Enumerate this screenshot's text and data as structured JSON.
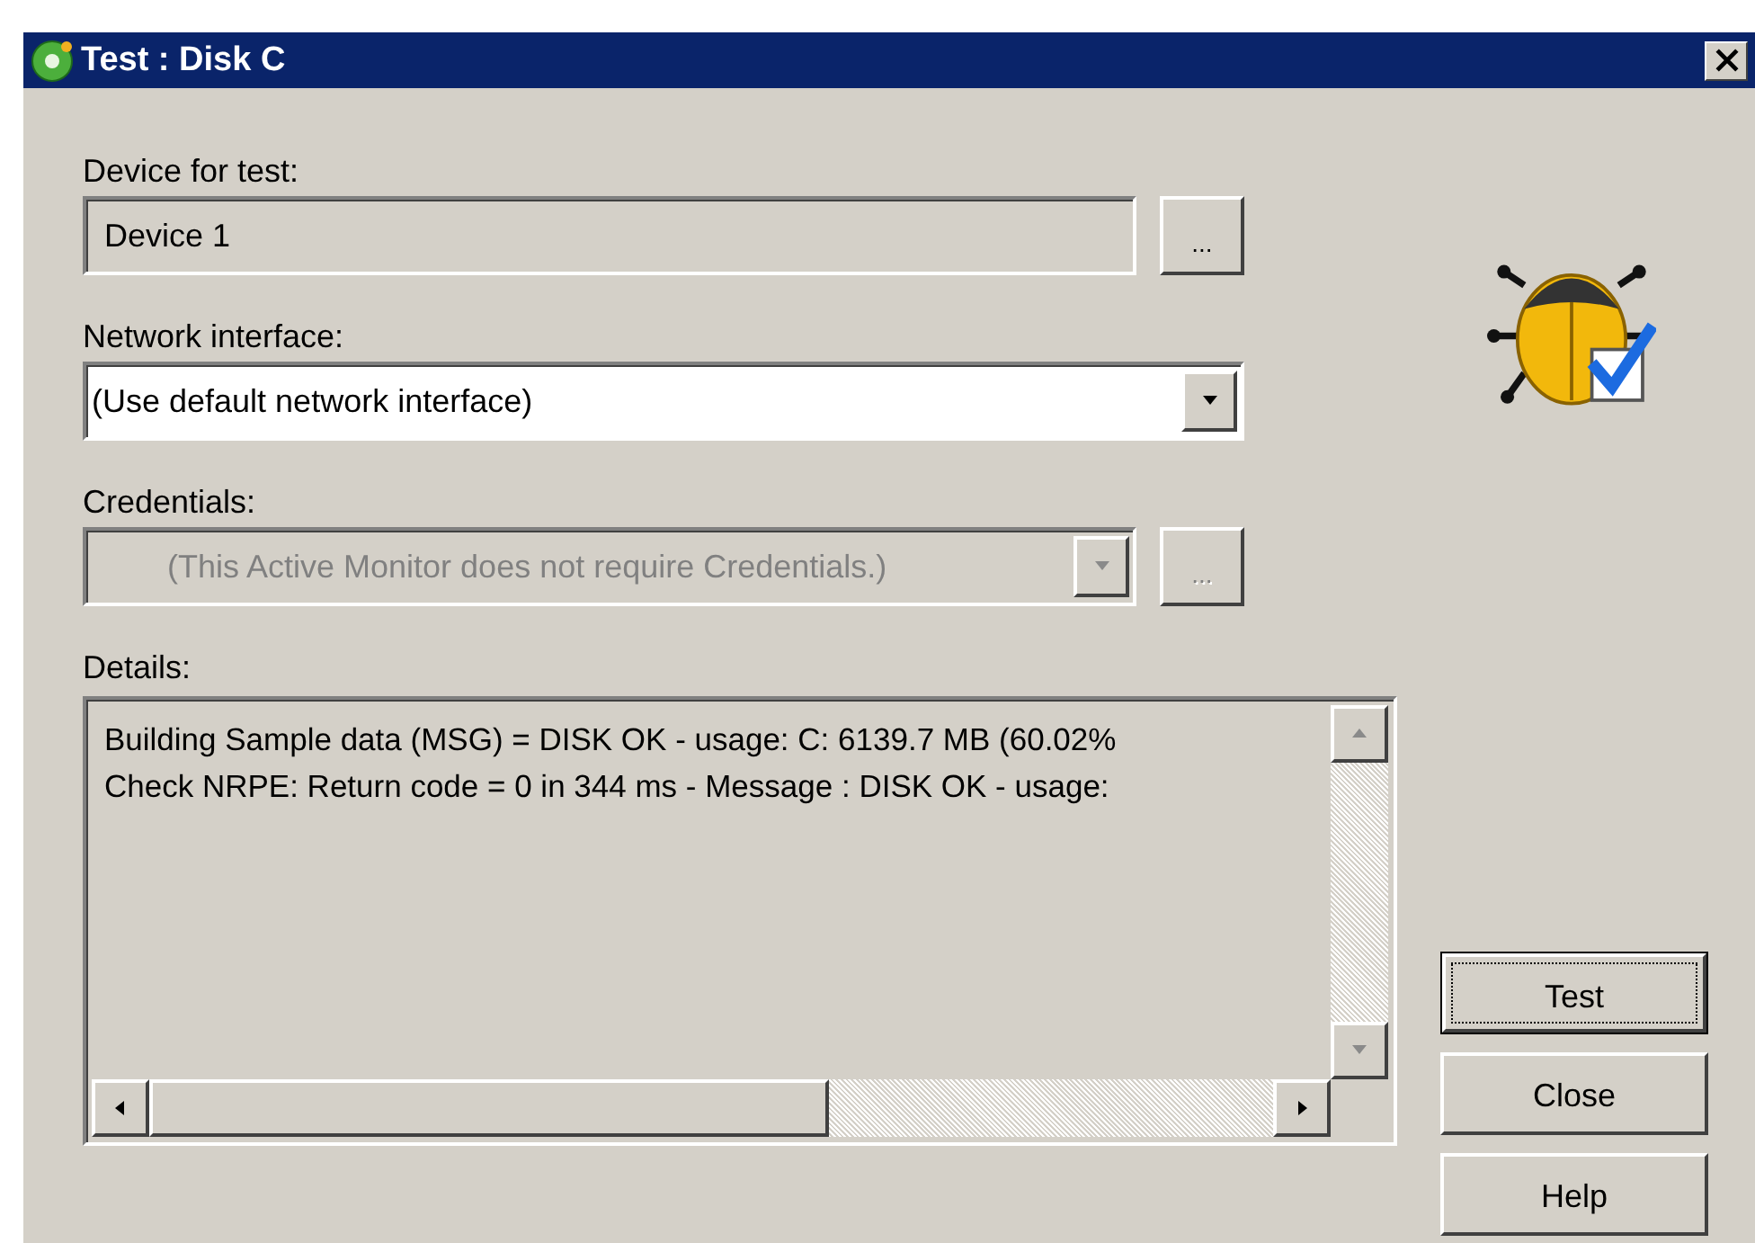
{
  "window": {
    "title": "Test : Disk C"
  },
  "device": {
    "label": "Device for test:",
    "value": "Device 1",
    "disabled": false,
    "browse": "..."
  },
  "network": {
    "label": "Network interface:",
    "value": "(Use default network interface)",
    "disabled": false
  },
  "credentials": {
    "label": "Credentials:",
    "value": "(This Active Monitor does not require Credentials.)",
    "disabled": true,
    "browse": "..."
  },
  "details": {
    "label": "Details:",
    "lines": [
      "Building Sample data (MSG) = DISK OK - usage: C: 6139.7 MB (60.02%",
      "Check NRPE: Return code = 0 in 344 ms - Message : DISK OK - usage:"
    ]
  },
  "buttons": [
    {
      "label": "Test",
      "default": true
    },
    {
      "label": "Close",
      "default": false
    },
    {
      "label": "Help",
      "default": false
    }
  ]
}
